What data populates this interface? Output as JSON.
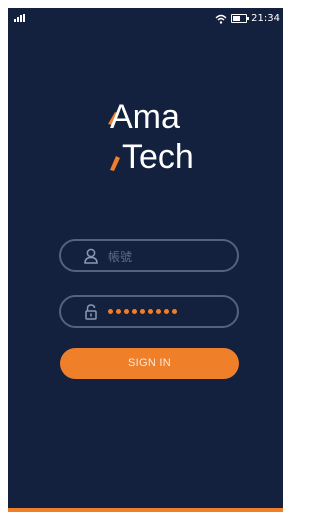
{
  "status_bar": {
    "time": "21:34",
    "battery_level": 0.6
  },
  "logo": {
    "line1": "Ama",
    "line2": "Tech"
  },
  "username_field": {
    "placeholder": "帳號",
    "icon": "user-icon"
  },
  "password_field": {
    "masked_length": 9,
    "icon": "lock-icon"
  },
  "signin_button": {
    "label": "SIGN IN"
  },
  "colors": {
    "background": "#13203e",
    "accent": "#f07f2a",
    "border": "#55627e"
  }
}
